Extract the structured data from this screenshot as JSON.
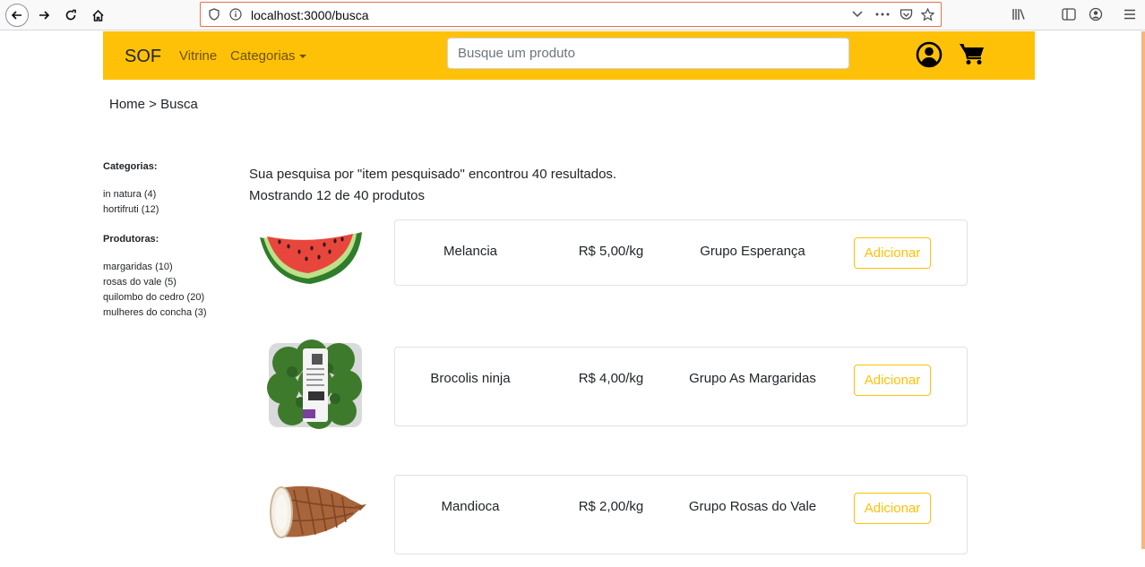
{
  "browser": {
    "url": "localhost:3000/busca"
  },
  "header": {
    "brand": "SOF",
    "nav_vitrine": "Vitrine",
    "nav_categorias": "Categorias",
    "search_placeholder": "Busque um produto"
  },
  "breadcrumb": "Home > Busca",
  "sidebar": {
    "categories_title": "Categorias:",
    "categories": [
      "in natura (4)",
      "hortifruti (12)"
    ],
    "producers_title": "Produtoras:",
    "producers": [
      "margaridas (10)",
      "rosas do vale (5)",
      "quilombo do cedro (20)",
      "mulheres do concha (3)"
    ]
  },
  "results": {
    "summary": "Sua pesquisa por \"item pesquisado\" encontrou 40 resultados.",
    "showing": "Mostrando 12 de 40 produtos"
  },
  "products": [
    {
      "name": "Melancia",
      "price": "R$ 5,00/kg",
      "producer": "Grupo Esperança",
      "button": "Adicionar"
    },
    {
      "name": "Brocolis ninja",
      "price": "R$ 4,00/kg",
      "producer": "Grupo As Margaridas",
      "button": "Adicionar"
    },
    {
      "name": "Mandioca",
      "price": "R$ 2,00/kg",
      "producer": "Grupo Rosas do Vale",
      "button": "Adicionar"
    }
  ],
  "colors": {
    "accent": "#ffc107",
    "text": "#212529"
  }
}
